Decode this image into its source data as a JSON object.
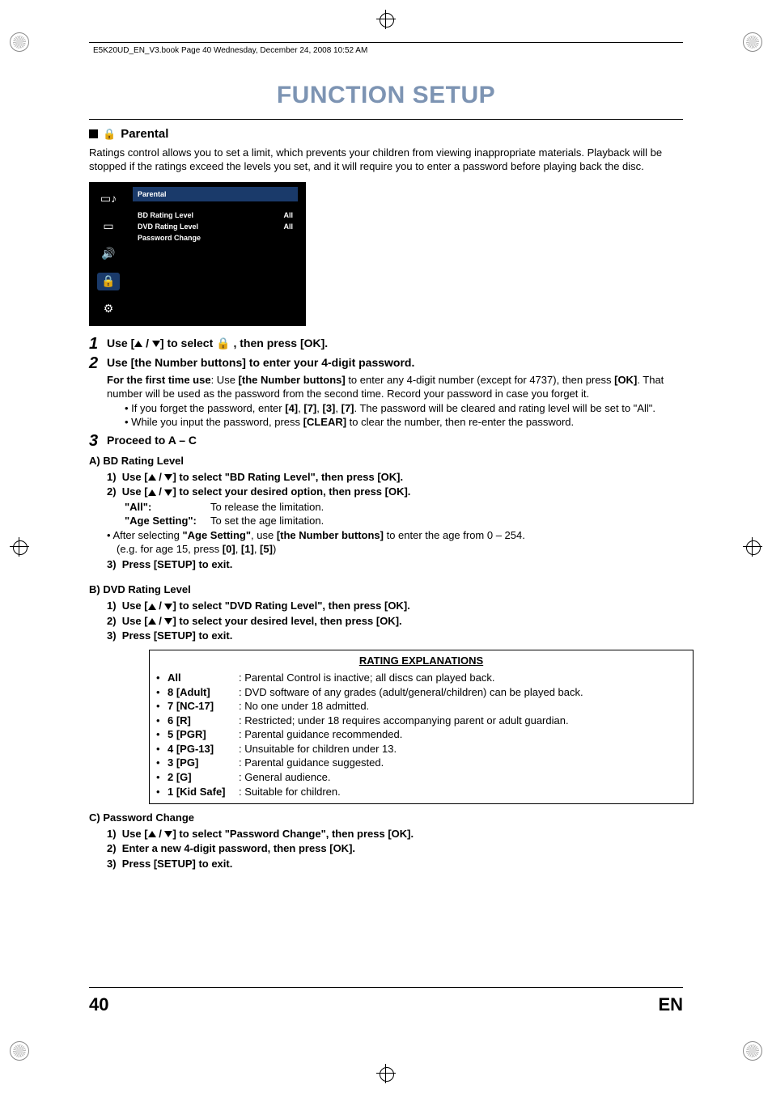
{
  "header": {
    "caption": "E5K20UD_EN_V3.book  Page 40  Wednesday, December 24, 2008  10:52 AM",
    "title": "FUNCTION SETUP"
  },
  "section": {
    "label": "Parental",
    "intro": "Ratings control allows you to set a limit, which prevents your children from viewing inappropriate materials. Playback will be stopped if the ratings exceed the levels you set, and it will require you to enter a password before playing back the disc."
  },
  "menu": {
    "title": "Parental",
    "rows": [
      {
        "label": "BD Rating Level",
        "value": "All"
      },
      {
        "label": "DVD Rating Level",
        "value": "All"
      },
      {
        "label": "Password Change",
        "value": ""
      }
    ]
  },
  "steps": {
    "s1_a": "Use [",
    "s1_b": " / ",
    "s1_c": "] to select ",
    "s1_d": " , then press [OK].",
    "s2": "Use [the Number buttons] to enter your 4-digit password.",
    "s2_body_a": "For the first time use",
    "s2_body_b": ": Use ",
    "s2_body_c": "[the Number buttons]",
    "s2_body_d": " to enter any 4-digit number (except for 4737), then press ",
    "s2_body_e": "[OK]",
    "s2_body_f": ". That number will be used as the password from the second time. Record your password in case you forget it.",
    "s2_bullet1_a": "If you forget the password, enter ",
    "s2_bullet1_b": "[4]",
    "s2_bullet1_c": ", ",
    "s2_bullet1_d": "[7]",
    "s2_bullet1_e": ", ",
    "s2_bullet1_f": "[3]",
    "s2_bullet1_g": ", ",
    "s2_bullet1_h": "[7]",
    "s2_bullet1_i": ". The password will be cleared and rating level will be set to \"All\".",
    "s2_bullet2_a": "While you input the password, press ",
    "s2_bullet2_b": "[CLEAR]",
    "s2_bullet2_c": " to clear the number, then re-enter the password.",
    "s3": "Proceed to A – C"
  },
  "A": {
    "title": "A)  BD Rating Level",
    "l1_a": "Use [",
    "l1_b": " / ",
    "l1_c": "] to select \"BD Rating Level\", then press [OK].",
    "l2_a": "Use [",
    "l2_b": " / ",
    "l2_c": "] to select your desired option, then press [OK].",
    "def1_k": "\"All\":",
    "def1_v": "To release the limitation.",
    "def2_k": "\"Age Setting\":",
    "def2_v": "To set the age limitation.",
    "note_a": "After selecting ",
    "note_b": "\"Age Setting\"",
    "note_c": ", use ",
    "note_d": "[the Number buttons]",
    "note_e": " to enter the age from 0 – 254.",
    "note2_a": "(e.g. for age 15, press ",
    "note2_b": "[0]",
    "note2_c": ", ",
    "note2_d": "[1]",
    "note2_e": ", ",
    "note2_f": "[5]",
    "note2_g": ")",
    "l3": "Press [SETUP] to exit."
  },
  "B": {
    "title": "B)  DVD Rating Level",
    "l1_a": "Use [",
    "l1_b": " / ",
    "l1_c": "] to select \"DVD Rating Level\", then press [OK].",
    "l2_a": "Use [",
    "l2_b": " / ",
    "l2_c": "] to select your desired level, then press [OK].",
    "l3": "Press [SETUP] to exit."
  },
  "ratings": {
    "title": "RATING EXPLANATIONS",
    "rows": [
      {
        "lvl": "All",
        "desc": ": Parental Control is inactive; all discs can played back."
      },
      {
        "lvl": "8 [Adult]",
        "desc": ": DVD software of any grades (adult/general/children) can be played back."
      },
      {
        "lvl": "7 [NC-17]",
        "desc": ":  No one under 18 admitted."
      },
      {
        "lvl": "6 [R]",
        "desc": ":  Restricted; under 18 requires accompanying parent or adult guardian."
      },
      {
        "lvl": "5 [PGR]",
        "desc": ":  Parental guidance recommended."
      },
      {
        "lvl": "4 [PG-13]",
        "desc": ":  Unsuitable for children under 13."
      },
      {
        "lvl": "3 [PG]",
        "desc": ":  Parental guidance suggested."
      },
      {
        "lvl": "2 [G]",
        "desc": ":  General audience."
      },
      {
        "lvl": "1 [Kid Safe]",
        "desc": ": Suitable for children."
      }
    ]
  },
  "C": {
    "title": "C)  Password Change",
    "l1_a": "Use [",
    "l1_b": " / ",
    "l1_c": "] to select \"Password Change\", then press [OK].",
    "l2": "Enter a new 4-digit password, then press [OK].",
    "l3": "Press [SETUP] to exit."
  },
  "footer": {
    "page": "40",
    "lang": "EN"
  },
  "labels": {
    "n1": "1)",
    "n2": "2)",
    "n3": "3)"
  }
}
